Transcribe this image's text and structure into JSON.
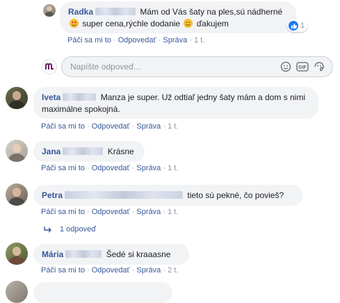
{
  "comments": [
    {
      "name": "Radka",
      "text_part1": "Mám od Vás šaty na ples,sú nádherné",
      "text_part2": "super cena,rýchle dodanie",
      "text_part3": "ďakujem",
      "emoji1": "heart-eyes-emoji",
      "emoji2": "smiling-emoji",
      "reactions_count": "1",
      "actions": {
        "like": "Páči sa mi to",
        "reply": "Odpovedať",
        "message": "Správa",
        "time": "1 t."
      }
    },
    {
      "name": "Iveta",
      "text": "Manza je super. Už odtiaľ jedny šaty mám a dom s nimi maximálne spokojná.",
      "actions": {
        "like": "Páči sa mi to",
        "reply": "Odpovedať",
        "message": "Správa",
        "time": "1 t."
      }
    },
    {
      "name": "Jana",
      "text": "Krásne",
      "actions": {
        "like": "Páči sa mi to",
        "reply": "Odpovedať",
        "message": "Správa",
        "time": "1 t."
      }
    },
    {
      "name": "Petra",
      "text": "tieto sú pekné, čo povieš?",
      "actions": {
        "like": "Páči sa mi to",
        "reply": "Odpovedať",
        "message": "Správa",
        "time": "1 t."
      },
      "replies_label": "1 odpoveď"
    },
    {
      "name": "Mária",
      "text": "Šedé si kraaasne",
      "actions": {
        "like": "Páči sa mi to",
        "reply": "Odpovedať",
        "message": "Správa",
        "time": "2 t."
      }
    }
  ],
  "reply_box": {
    "placeholder": "Napíšte odpoveď..."
  },
  "reply_tools": [
    "emoji-icon",
    "gif-icon",
    "sticker-icon"
  ],
  "colors": {
    "link": "#385898",
    "bubble": "#f2f3f5",
    "meta": "#90949c",
    "like": "#2078f4"
  }
}
